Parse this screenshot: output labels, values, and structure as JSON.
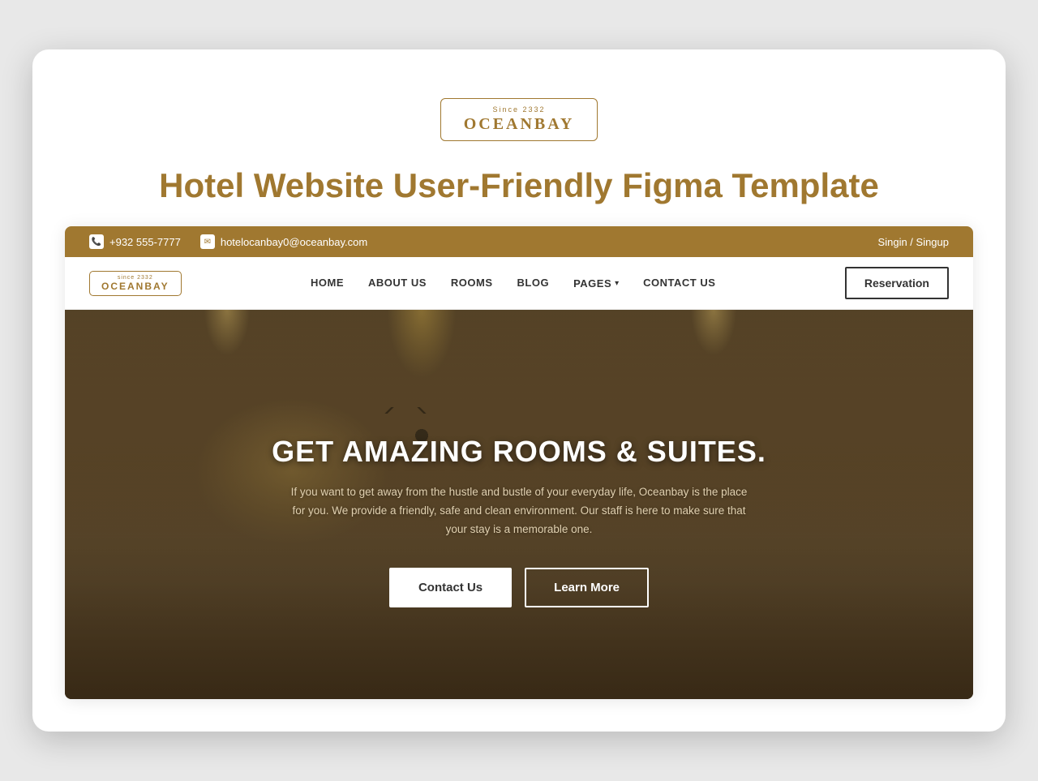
{
  "device": {
    "page_title": "Hotel Website User-Friendly Figma Template"
  },
  "logo": {
    "since": "Since 2332",
    "name": "OCEANBAY"
  },
  "topbar": {
    "phone": "+932 555-7777",
    "email": "hotelocanbay0@oceanbay.com",
    "auth": "Singin / Singup"
  },
  "navbar": {
    "nav_logo_since": "since 2332",
    "nav_logo_name": "OCEANBAY",
    "links": [
      {
        "label": "HOME",
        "id": "home"
      },
      {
        "label": "ABOUT US",
        "id": "about"
      },
      {
        "label": "ROOMS",
        "id": "rooms"
      },
      {
        "label": "BLOG",
        "id": "blog"
      },
      {
        "label": "PAGES",
        "id": "pages",
        "has_dropdown": true
      },
      {
        "label": "CONTACT US",
        "id": "contact"
      }
    ],
    "reservation_btn": "Reservation"
  },
  "hero": {
    "title": "GET AMAZING ROOMS & SUITES.",
    "subtitle": "If you want to get away from the hustle and bustle of your everyday life, Oceanbay is the place for you. We provide a friendly, safe and clean environment. Our staff is here to make sure that your stay is a memorable one.",
    "contact_btn": "Contact Us",
    "learn_btn": "Learn More"
  }
}
